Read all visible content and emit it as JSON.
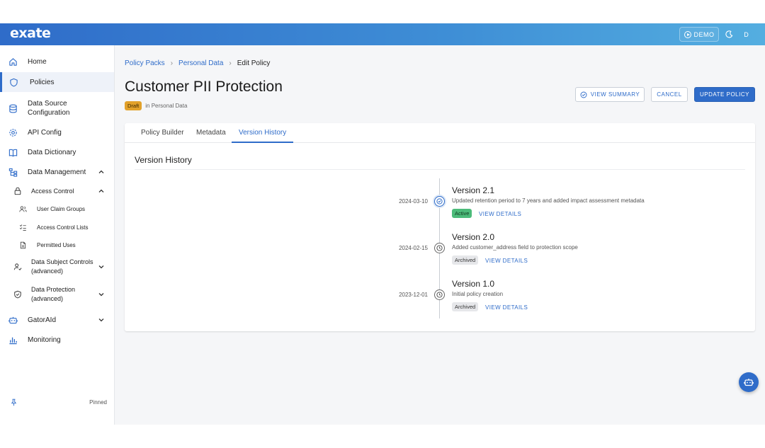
{
  "app": {
    "logo": "exate",
    "demo_label": "DEMO",
    "avatar_initial": "D"
  },
  "colors": {
    "accent": "#2f6cc9",
    "draft": "#e2a12a",
    "active": "#4cbb7a"
  },
  "sidebar": {
    "items": [
      {
        "label": "Home",
        "icon": "home-icon"
      },
      {
        "label": "Policies",
        "icon": "shield-icon"
      },
      {
        "label": "Data Source Configuration",
        "icon": "database-icon"
      },
      {
        "label": "API Config",
        "icon": "gear-icon"
      },
      {
        "label": "Data Dictionary",
        "icon": "book-icon"
      },
      {
        "label": "Data Management",
        "icon": "tree-icon"
      },
      {
        "label": "Access Control",
        "icon": "lock-icon"
      },
      {
        "label": "User Claim Groups",
        "icon": "users-icon"
      },
      {
        "label": "Access Control Lists",
        "icon": "checklist-icon"
      },
      {
        "label": "Permitted Uses",
        "icon": "document-icon"
      },
      {
        "label": "Data Subject Controls (advanced)",
        "icon": "user-check-icon"
      },
      {
        "label": "Data Protection (advanced)",
        "icon": "shield-check-icon"
      },
      {
        "label": "GatorAId",
        "icon": "robot-icon"
      },
      {
        "label": "Monitoring",
        "icon": "bar-chart-icon"
      }
    ],
    "pinned_label": "Pinned"
  },
  "breadcrumb": {
    "items": [
      "Policy Packs",
      "Personal Data"
    ],
    "current": "Edit Policy"
  },
  "page": {
    "title": "Customer PII Protection",
    "status": "Draft",
    "context": "in Personal Data",
    "buttons": {
      "view_summary": "VIEW SUMMARY",
      "cancel": "CANCEL",
      "update": "UPDATE POLICY"
    }
  },
  "tabs": [
    "Policy Builder",
    "Metadata",
    "Version History"
  ],
  "version_history": {
    "title": "Version History",
    "view_details_label": "VIEW DETAILS",
    "versions": [
      {
        "title": "Version 2.1",
        "date": "2024-03-10",
        "description": "Updated retention period to 7 years and added impact assessment metadata",
        "status": "Active"
      },
      {
        "title": "Version 2.0",
        "date": "2024-02-15",
        "description": "Added customer_address field to protection scope",
        "status": "Archived"
      },
      {
        "title": "Version 1.0",
        "date": "2023-12-01",
        "description": "Initial policy creation",
        "status": "Archived"
      }
    ]
  }
}
